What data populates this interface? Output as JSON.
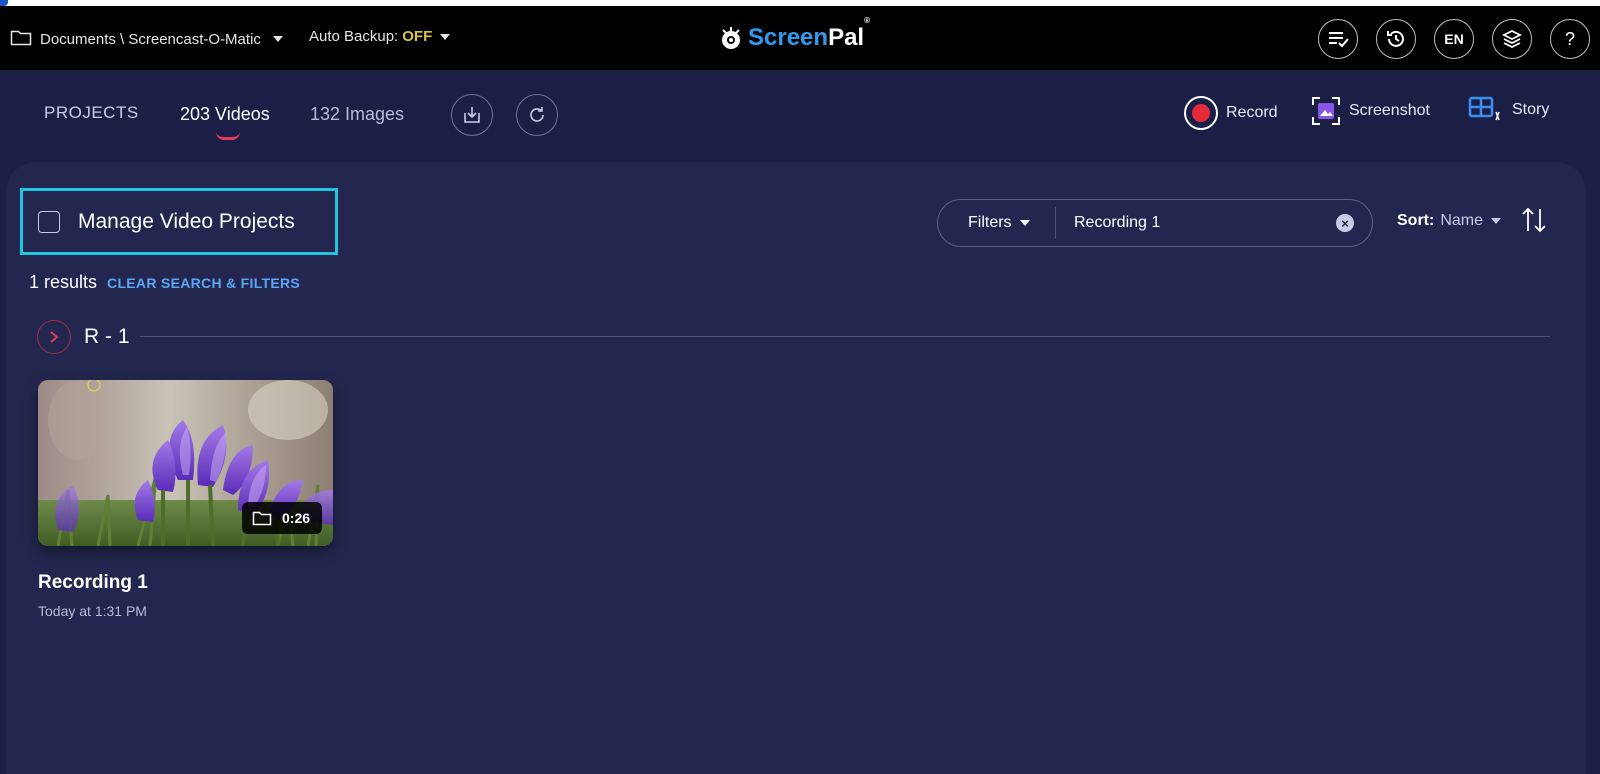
{
  "topbar": {
    "path": "Documents \\ Screencast-O-Matic",
    "backup_label": "Auto Backup:",
    "backup_value": "OFF",
    "logo_screen": "Screen",
    "logo_pal": "Pal",
    "logo_reg": "®",
    "lang": "EN",
    "help": "?"
  },
  "projects": {
    "label": "PROJECTS",
    "tab_videos": "203 Videos",
    "tab_images": "132 Images",
    "record": "Record",
    "screenshot": "Screenshot",
    "story": "Story"
  },
  "main": {
    "manage_label": "Manage Video Projects",
    "filters_label": "Filters",
    "search_value": "Recording 1",
    "sort_label": "Sort:",
    "sort_value": "Name",
    "results_count": "1 results",
    "clear_label": "CLEAR SEARCH & FILTERS",
    "group_label": "R - 1"
  },
  "card": {
    "duration": "0:26",
    "title": "Recording 1",
    "date": "Today at 1:31 PM"
  },
  "colors": {
    "accent_cyan": "#1fc6e0",
    "record_red": "#e52a3a",
    "link_blue": "#59a7f5",
    "backup_off": "#d8c44a"
  }
}
